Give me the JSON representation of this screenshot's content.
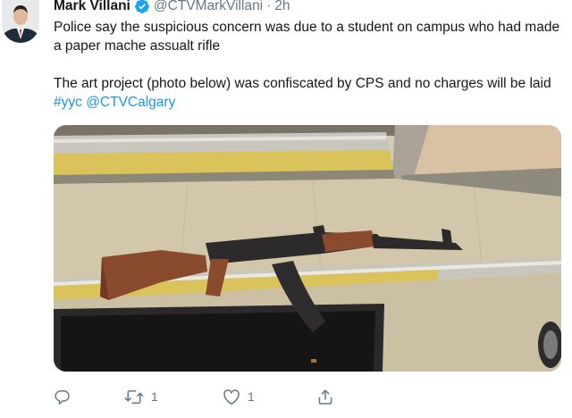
{
  "tweet": {
    "author": {
      "name": "Mark Villani",
      "handle": "@CTVMarkVillani",
      "verified": true
    },
    "separator": "·",
    "time": "2h",
    "text": {
      "para1": "Police say the suspicious concern was due to a student on campus who had made a paper mache assualt rifle",
      "para2_prefix": "The art project (photo below) was confiscated by CPS and no charges will be laid ",
      "hashtag": "#yyc",
      "mention": "@CTVCalgary"
    },
    "media": {
      "icon": "photo",
      "description_icon": "paper-mache-rifle-photo"
    },
    "actions": {
      "reply_count": "",
      "retweet_count": "1",
      "like_count": "1"
    }
  },
  "colors": {
    "text": "#14171a",
    "secondary": "#657786",
    "link": "#1b95e0",
    "verified": "#1da1f2"
  }
}
